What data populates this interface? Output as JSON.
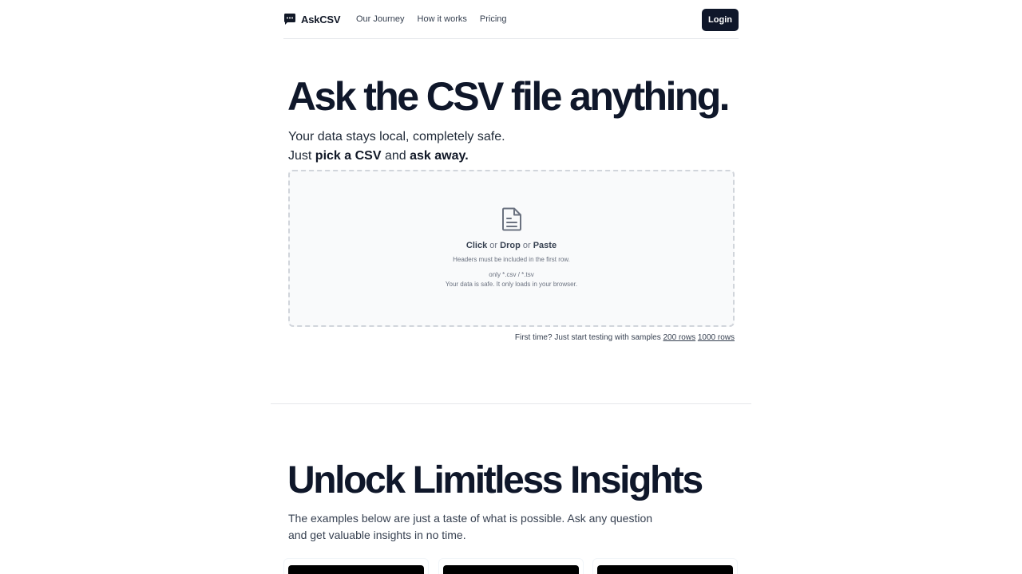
{
  "brand": {
    "name": "AskCSV",
    "logo_icon": "chat-bubble-icon"
  },
  "nav": {
    "items": [
      "Our Journey",
      "How it works",
      "Pricing"
    ]
  },
  "header": {
    "login_label": "Login"
  },
  "hero": {
    "title": "Ask the CSV file anything.",
    "subtitle_line1": "Your data stays local, completely safe.",
    "subtitle_line2_prefix": "Just ",
    "subtitle_line2_bold1": "pick a CSV",
    "subtitle_line2_mid": " and ",
    "subtitle_line2_bold2": "ask away."
  },
  "dropzone": {
    "icon": "file-text-icon",
    "action_click": "Click",
    "or1": " or ",
    "action_drop": "Drop",
    "or2": " or ",
    "action_paste": "Paste",
    "headers_note": "Headers must be included in the first row.",
    "formats": "only *.csv / *.tsv",
    "safety_note": "Your data is safe. It only loads in your browser."
  },
  "samples": {
    "prefix": "First time? Just start testing with samples ",
    "link_200": "200 rows",
    "link_1000": "1000 rows"
  },
  "insights": {
    "title": "Unlock Limitless Insights",
    "description": "The examples below are just a taste of what is possible. Ask any question and get valuable insights in no time."
  },
  "colors": {
    "primary": "#0f172a",
    "text": "#111827",
    "muted": "#6b7280",
    "border": "#d1d5db"
  }
}
